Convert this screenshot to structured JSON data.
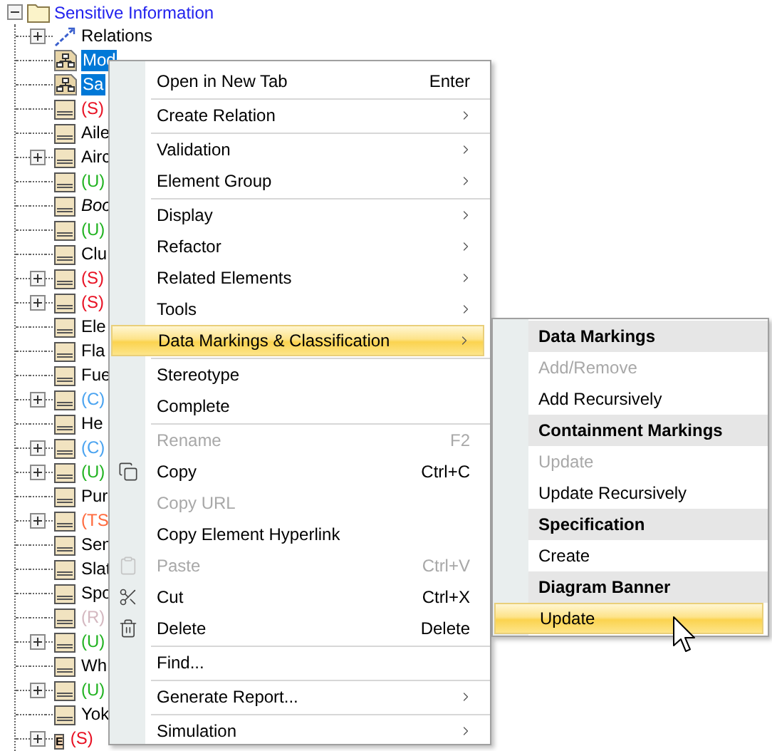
{
  "tree": {
    "root": {
      "label": "Sensitive Information",
      "expanded": true
    },
    "children": [
      {
        "kind": "relations",
        "expandable": true,
        "selected": false,
        "abstract": false,
        "name": "Relations"
      },
      {
        "kind": "diagram",
        "expandable": false,
        "selected": true,
        "abstract": false,
        "name": "Mod"
      },
      {
        "kind": "diagram",
        "expandable": false,
        "selected": true,
        "abstract": false,
        "name": "Sa"
      },
      {
        "kind": "block",
        "expandable": false,
        "selected": false,
        "abstract": false,
        "marking": "(S)",
        "color": "#e81123"
      },
      {
        "kind": "block",
        "expandable": false,
        "selected": false,
        "abstract": false,
        "name": "Aile"
      },
      {
        "kind": "block",
        "expandable": true,
        "selected": false,
        "abstract": false,
        "name": "Airc"
      },
      {
        "kind": "block",
        "expandable": false,
        "selected": false,
        "abstract": false,
        "marking": "(U)",
        "color": "#22b322"
      },
      {
        "kind": "block",
        "expandable": false,
        "selected": false,
        "abstract": true,
        "name": "Boo"
      },
      {
        "kind": "block",
        "expandable": false,
        "selected": false,
        "abstract": false,
        "marking": "(U)",
        "color": "#22b322"
      },
      {
        "kind": "block",
        "expandable": false,
        "selected": false,
        "abstract": false,
        "name": "Clu"
      },
      {
        "kind": "block",
        "expandable": true,
        "selected": false,
        "abstract": false,
        "marking": "(S)",
        "color": "#e81123"
      },
      {
        "kind": "block",
        "expandable": true,
        "selected": false,
        "abstract": false,
        "marking": "(S)",
        "color": "#e81123"
      },
      {
        "kind": "block",
        "expandable": false,
        "selected": false,
        "abstract": false,
        "name": "Ele"
      },
      {
        "kind": "block",
        "expandable": false,
        "selected": false,
        "abstract": false,
        "name": "Fla"
      },
      {
        "kind": "block",
        "expandable": false,
        "selected": false,
        "abstract": false,
        "name": "Fue"
      },
      {
        "kind": "block",
        "expandable": true,
        "selected": false,
        "abstract": false,
        "marking": "(C)",
        "color": "#4aa3f0"
      },
      {
        "kind": "block",
        "expandable": false,
        "selected": false,
        "abstract": false,
        "name": "He"
      },
      {
        "kind": "block",
        "expandable": true,
        "selected": false,
        "abstract": false,
        "marking": "(C)",
        "color": "#4aa3f0"
      },
      {
        "kind": "block",
        "expandable": true,
        "selected": false,
        "abstract": false,
        "marking": "(U)",
        "color": "#22b322"
      },
      {
        "kind": "block",
        "expandable": false,
        "selected": false,
        "abstract": false,
        "name": "Pur"
      },
      {
        "kind": "block",
        "expandable": true,
        "selected": false,
        "abstract": false,
        "marking": "(TS",
        "color": "#ff6a3d"
      },
      {
        "kind": "block",
        "expandable": false,
        "selected": false,
        "abstract": false,
        "name": "Sen"
      },
      {
        "kind": "block",
        "expandable": false,
        "selected": false,
        "abstract": false,
        "name": "Slat"
      },
      {
        "kind": "block",
        "expandable": false,
        "selected": false,
        "abstract": false,
        "name": "Spo"
      },
      {
        "kind": "block",
        "expandable": false,
        "selected": false,
        "abstract": false,
        "marking": "(R)",
        "color": "#d4b8c0"
      },
      {
        "kind": "block",
        "expandable": true,
        "selected": false,
        "abstract": false,
        "marking": "(U)",
        "color": "#22b322"
      },
      {
        "kind": "block",
        "expandable": false,
        "selected": false,
        "abstract": false,
        "name": "Wh"
      },
      {
        "kind": "block",
        "expandable": true,
        "selected": false,
        "abstract": false,
        "marking": "(U)",
        "color": "#22b322"
      },
      {
        "kind": "block",
        "expandable": false,
        "selected": false,
        "abstract": false,
        "name": "Yok"
      },
      {
        "kind": "enum",
        "expandable": true,
        "selected": false,
        "abstract": false,
        "badge": "E",
        "marking": "(S)",
        "color": "#e81123"
      }
    ]
  },
  "context_menu": {
    "items": [
      {
        "kind": "item",
        "label": "Open in New Tab",
        "shortcut": "Enter",
        "submenu": false,
        "disabled": false,
        "selected": false
      },
      {
        "kind": "separator"
      },
      {
        "kind": "item",
        "label": "Create Relation",
        "submenu": true,
        "disabled": false,
        "selected": false
      },
      {
        "kind": "separator"
      },
      {
        "kind": "item",
        "label": "Validation",
        "submenu": true,
        "disabled": false,
        "selected": false
      },
      {
        "kind": "item",
        "label": "Element Group",
        "submenu": true,
        "disabled": false,
        "selected": false
      },
      {
        "kind": "separator"
      },
      {
        "kind": "item",
        "label": "Display",
        "submenu": true,
        "disabled": false,
        "selected": false
      },
      {
        "kind": "item",
        "label": "Refactor",
        "submenu": true,
        "disabled": false,
        "selected": false
      },
      {
        "kind": "item",
        "label": "Related Elements",
        "submenu": true,
        "disabled": false,
        "selected": false
      },
      {
        "kind": "item",
        "label": "Tools",
        "submenu": true,
        "disabled": false,
        "selected": false
      },
      {
        "kind": "item",
        "label": "Data Markings & Classification",
        "submenu": true,
        "disabled": false,
        "selected": true
      },
      {
        "kind": "separator"
      },
      {
        "kind": "item",
        "label": "Stereotype",
        "submenu": false,
        "disabled": false,
        "selected": false
      },
      {
        "kind": "item",
        "label": "Complete",
        "submenu": false,
        "disabled": false,
        "selected": false
      },
      {
        "kind": "separator"
      },
      {
        "kind": "item",
        "label": "Rename",
        "shortcut": "F2",
        "submenu": false,
        "disabled": true,
        "selected": false
      },
      {
        "kind": "item",
        "label": "Copy",
        "shortcut": "Ctrl+C",
        "submenu": false,
        "disabled": false,
        "selected": false
      },
      {
        "kind": "item",
        "label": "Copy URL",
        "submenu": false,
        "disabled": true,
        "selected": false
      },
      {
        "kind": "item",
        "label": "Copy Element Hyperlink",
        "submenu": false,
        "disabled": false,
        "selected": false
      },
      {
        "kind": "item",
        "label": "Paste",
        "shortcut": "Ctrl+V",
        "submenu": false,
        "disabled": true,
        "selected": false
      },
      {
        "kind": "item",
        "label": "Cut",
        "shortcut": "Ctrl+X",
        "submenu": false,
        "disabled": false,
        "selected": false
      },
      {
        "kind": "item",
        "label": "Delete",
        "shortcut": "Delete",
        "submenu": false,
        "disabled": false,
        "selected": false
      },
      {
        "kind": "separator"
      },
      {
        "kind": "item",
        "label": "Find...",
        "submenu": false,
        "disabled": false,
        "selected": false
      },
      {
        "kind": "separator"
      },
      {
        "kind": "item",
        "label": "Generate Report...",
        "submenu": true,
        "disabled": false,
        "selected": false
      },
      {
        "kind": "separator"
      },
      {
        "kind": "item",
        "label": "Simulation",
        "submenu": true,
        "disabled": false,
        "selected": false
      }
    ]
  },
  "submenu": {
    "items": [
      {
        "kind": "header",
        "label": "Data Markings"
      },
      {
        "kind": "item",
        "label": "Add/Remove",
        "disabled": true,
        "selected": false
      },
      {
        "kind": "item",
        "label": "Add Recursively",
        "disabled": false,
        "selected": false
      },
      {
        "kind": "header",
        "label": "Containment Markings"
      },
      {
        "kind": "item",
        "label": "Update",
        "disabled": true,
        "selected": false
      },
      {
        "kind": "item",
        "label": "Update Recursively",
        "disabled": false,
        "selected": false
      },
      {
        "kind": "header",
        "label": "Specification"
      },
      {
        "kind": "item",
        "label": "Create",
        "disabled": false,
        "selected": false
      },
      {
        "kind": "header",
        "label": "Diagram Banner"
      },
      {
        "kind": "item",
        "label": "Update",
        "disabled": false,
        "selected": true
      }
    ]
  }
}
